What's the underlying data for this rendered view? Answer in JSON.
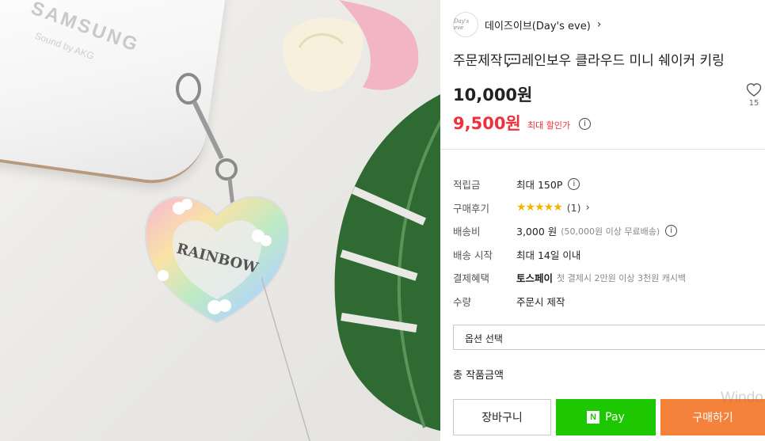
{
  "image": {
    "case_brand": "SAMSUNG",
    "case_sub": "Sound by AKG",
    "charm_text": "RAINBOW"
  },
  "shop": {
    "logo_text": "Day's eve",
    "name": "데이즈이브(Day's eve)",
    "chevron": "›"
  },
  "product": {
    "title_before": "주문제작",
    "title_after": "레인보우 클라우드 미니 쉐이커 키링",
    "price_original": "10,000원",
    "price_sale": "9,500원",
    "discount_label": "최대 할인가",
    "wish_count": "15"
  },
  "info_rows": {
    "points": {
      "label": "적립금",
      "value": "최대 150P"
    },
    "reviews": {
      "label": "구매후기",
      "stars": "★★★★★",
      "count": "(1)",
      "chevron": "›"
    },
    "shipping": {
      "label": "배송비",
      "value": "3,000 원",
      "note": "(50,000원 이상 무료배송)"
    },
    "ship_start": {
      "label": "배송 시작",
      "value": "최대 14일 이내"
    },
    "payment_benefit": {
      "label": "결제혜택",
      "value": "토스페이",
      "note": "첫 결제시 2만원 이상 3천원 캐시백"
    },
    "quantity": {
      "label": "수량",
      "value": "주문시 제작"
    }
  },
  "option": {
    "placeholder": "옵션 선택"
  },
  "total": {
    "label": "총 작품금액"
  },
  "buttons": {
    "cart": "장바구니",
    "npay_logo": "N",
    "npay": "Pay",
    "buy": "구매하기"
  },
  "watermark": "Windo",
  "colors": {
    "sale_red": "#f0303c",
    "star_yellow": "#f5b400",
    "npay_green": "#1ec800",
    "buy_orange": "#f5823a"
  },
  "icons": [
    "chat-bubble-icon",
    "info-icon",
    "heart-icon",
    "chevron-right-icon",
    "star-icon",
    "naver-n-icon"
  ]
}
